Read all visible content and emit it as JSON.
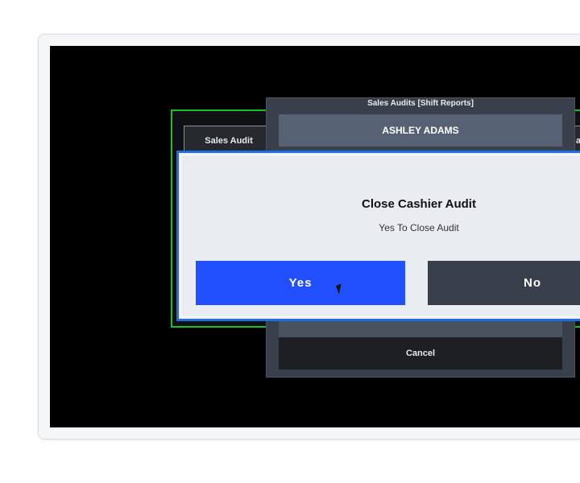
{
  "background_window": {
    "tab_left_label": "Sales Audit",
    "tab_right_label": "ail"
  },
  "middle_panel": {
    "title": "Sales Audits [Shift Reports]",
    "user_name": "ASHLEY ADAMS",
    "cancel_label": "Cancel"
  },
  "dialog": {
    "title": "Close Cashier Audit",
    "message": "Yes To Close Audit",
    "yes_label": "Yes",
    "no_label": "No",
    "colors": {
      "border": "#1d6fe0",
      "yes_button": "#2350ff",
      "no_button": "#3a404b"
    }
  },
  "colors": {
    "screen_background": "#000000",
    "background_window_border": "#1fbf2a"
  },
  "cursor_icon": "arrow-pointer-icon"
}
